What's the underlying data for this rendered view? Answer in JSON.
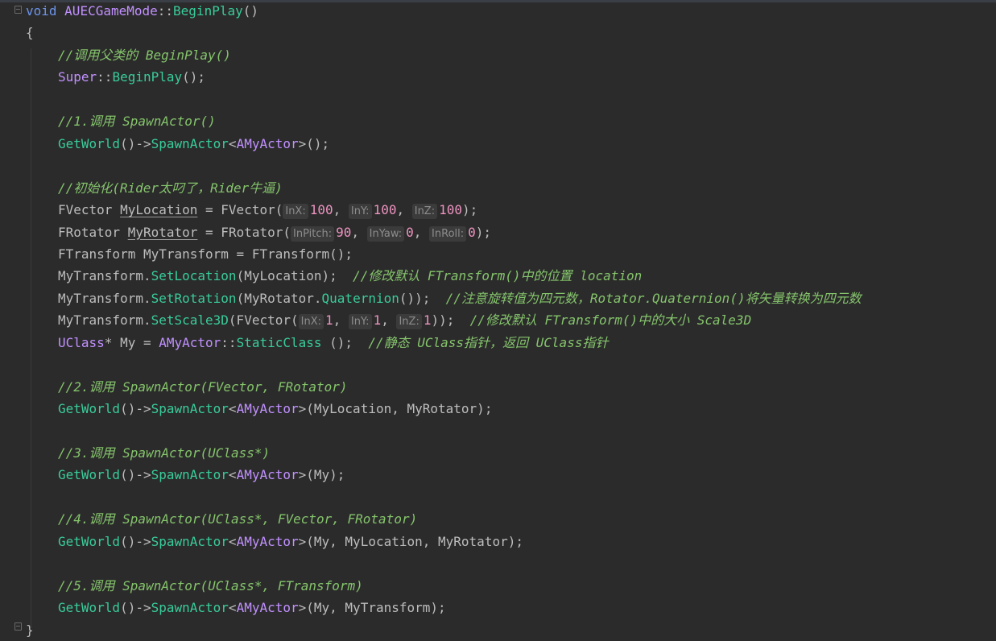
{
  "editor": {
    "lines": [
      {
        "indent": 0,
        "tokens": [
          {
            "kind": "keyword",
            "text": "void"
          },
          {
            "kind": "plain",
            "text": " "
          },
          {
            "kind": "type",
            "text": "AUECGameMode"
          },
          {
            "kind": "plain",
            "text": "::"
          },
          {
            "kind": "func",
            "text": "BeginPlay"
          },
          {
            "kind": "plain",
            "text": "()"
          }
        ]
      },
      {
        "indent": 0,
        "tokens": [
          {
            "kind": "plain",
            "text": "{"
          }
        ]
      },
      {
        "indent": 1,
        "tokens": [
          {
            "kind": "comment",
            "text": "//调用父类的 BeginPlay()"
          }
        ]
      },
      {
        "indent": 1,
        "tokens": [
          {
            "kind": "type",
            "text": "Super"
          },
          {
            "kind": "plain",
            "text": "::"
          },
          {
            "kind": "func",
            "text": "BeginPlay"
          },
          {
            "kind": "plain",
            "text": "();"
          }
        ]
      },
      {
        "indent": 1,
        "tokens": []
      },
      {
        "indent": 1,
        "tokens": [
          {
            "kind": "comment",
            "text": "//1.调用 SpawnActor()"
          }
        ]
      },
      {
        "indent": 1,
        "tokens": [
          {
            "kind": "func",
            "text": "GetWorld"
          },
          {
            "kind": "plain",
            "text": "()->"
          },
          {
            "kind": "func",
            "text": "SpawnActor"
          },
          {
            "kind": "plain",
            "text": "<"
          },
          {
            "kind": "type",
            "text": "AMyActor"
          },
          {
            "kind": "plain",
            "text": ">();"
          }
        ]
      },
      {
        "indent": 1,
        "tokens": []
      },
      {
        "indent": 1,
        "tokens": [
          {
            "kind": "comment",
            "text": "//初始化(Rider太叼了，Rider牛逼)"
          }
        ]
      },
      {
        "indent": 1,
        "tokens": [
          {
            "kind": "plain",
            "text": "FVector "
          },
          {
            "kind": "underline",
            "text": "MyLocation"
          },
          {
            "kind": "plain",
            "text": " = FVector("
          },
          {
            "kind": "hint",
            "text": "InX:"
          },
          {
            "kind": "num",
            "text": "100"
          },
          {
            "kind": "plain",
            "text": ", "
          },
          {
            "kind": "hint",
            "text": "InY:"
          },
          {
            "kind": "num",
            "text": "100"
          },
          {
            "kind": "plain",
            "text": ", "
          },
          {
            "kind": "hint",
            "text": "InZ:"
          },
          {
            "kind": "num",
            "text": "100"
          },
          {
            "kind": "plain",
            "text": ");"
          }
        ]
      },
      {
        "indent": 1,
        "tokens": [
          {
            "kind": "plain",
            "text": "FRotator "
          },
          {
            "kind": "underline",
            "text": "MyRotator"
          },
          {
            "kind": "plain",
            "text": " = FRotator("
          },
          {
            "kind": "hint",
            "text": "InPitch:"
          },
          {
            "kind": "num",
            "text": "90"
          },
          {
            "kind": "plain",
            "text": ", "
          },
          {
            "kind": "hint",
            "text": "InYaw:"
          },
          {
            "kind": "num",
            "text": "0"
          },
          {
            "kind": "plain",
            "text": ", "
          },
          {
            "kind": "hint",
            "text": "InRoll:"
          },
          {
            "kind": "num",
            "text": "0"
          },
          {
            "kind": "plain",
            "text": ");"
          }
        ]
      },
      {
        "indent": 1,
        "tokens": [
          {
            "kind": "plain",
            "text": "FTransform MyTransform = FTransform();"
          }
        ]
      },
      {
        "indent": 1,
        "tokens": [
          {
            "kind": "plain",
            "text": "MyTransform."
          },
          {
            "kind": "func",
            "text": "SetLocation"
          },
          {
            "kind": "plain",
            "text": "(MyLocation);  "
          },
          {
            "kind": "comment",
            "text": "//修改默认 FTransform()中的位置 location"
          }
        ]
      },
      {
        "indent": 1,
        "tokens": [
          {
            "kind": "plain",
            "text": "MyTransform."
          },
          {
            "kind": "func",
            "text": "SetRotation"
          },
          {
            "kind": "plain",
            "text": "(MyRotator."
          },
          {
            "kind": "func",
            "text": "Quaternion"
          },
          {
            "kind": "plain",
            "text": "());  "
          },
          {
            "kind": "comment",
            "text": "//注意旋转值为四元数，Rotator.Quaternion()将矢量转换为四元数"
          }
        ]
      },
      {
        "indent": 1,
        "tokens": [
          {
            "kind": "plain",
            "text": "MyTransform."
          },
          {
            "kind": "func",
            "text": "SetScale3D"
          },
          {
            "kind": "plain",
            "text": "(FVector("
          },
          {
            "kind": "hint",
            "text": "InX:"
          },
          {
            "kind": "num",
            "text": "1"
          },
          {
            "kind": "plain",
            "text": ", "
          },
          {
            "kind": "hint",
            "text": "InY:"
          },
          {
            "kind": "num",
            "text": "1"
          },
          {
            "kind": "plain",
            "text": ", "
          },
          {
            "kind": "hint",
            "text": "InZ:"
          },
          {
            "kind": "num",
            "text": "1"
          },
          {
            "kind": "plain",
            "text": "));  "
          },
          {
            "kind": "comment",
            "text": "//修改默认 FTransform()中的大小 Scale3D"
          }
        ]
      },
      {
        "indent": 1,
        "tokens": [
          {
            "kind": "type",
            "text": "UClass"
          },
          {
            "kind": "plain",
            "text": "* My = "
          },
          {
            "kind": "type",
            "text": "AMyActor"
          },
          {
            "kind": "plain",
            "text": "::"
          },
          {
            "kind": "func",
            "text": "StaticClass"
          },
          {
            "kind": "plain",
            "text": " ();  "
          },
          {
            "kind": "comment",
            "text": "//静态 UClass指针，返回 UClass指针"
          }
        ]
      },
      {
        "indent": 1,
        "tokens": []
      },
      {
        "indent": 1,
        "tokens": [
          {
            "kind": "comment",
            "text": "//2.调用 SpawnActor(FVector, FRotator)"
          }
        ]
      },
      {
        "indent": 1,
        "tokens": [
          {
            "kind": "func",
            "text": "GetWorld"
          },
          {
            "kind": "plain",
            "text": "()->"
          },
          {
            "kind": "func",
            "text": "SpawnActor"
          },
          {
            "kind": "plain",
            "text": "<"
          },
          {
            "kind": "type",
            "text": "AMyActor"
          },
          {
            "kind": "plain",
            "text": ">(MyLocation, MyRotator);"
          }
        ]
      },
      {
        "indent": 1,
        "tokens": []
      },
      {
        "indent": 1,
        "tokens": [
          {
            "kind": "comment",
            "text": "//3.调用 SpawnActor(UClass*)"
          }
        ]
      },
      {
        "indent": 1,
        "tokens": [
          {
            "kind": "func",
            "text": "GetWorld"
          },
          {
            "kind": "plain",
            "text": "()->"
          },
          {
            "kind": "func",
            "text": "SpawnActor"
          },
          {
            "kind": "plain",
            "text": "<"
          },
          {
            "kind": "type",
            "text": "AMyActor"
          },
          {
            "kind": "plain",
            "text": ">(My);"
          }
        ]
      },
      {
        "indent": 1,
        "tokens": []
      },
      {
        "indent": 1,
        "tokens": [
          {
            "kind": "comment",
            "text": "//4.调用 SpawnActor(UClass*, FVector, FRotator)"
          }
        ]
      },
      {
        "indent": 1,
        "tokens": [
          {
            "kind": "func",
            "text": "GetWorld"
          },
          {
            "kind": "plain",
            "text": "()->"
          },
          {
            "kind": "func",
            "text": "SpawnActor"
          },
          {
            "kind": "plain",
            "text": "<"
          },
          {
            "kind": "type",
            "text": "AMyActor"
          },
          {
            "kind": "plain",
            "text": ">(My, MyLocation, MyRotator);"
          }
        ]
      },
      {
        "indent": 1,
        "tokens": []
      },
      {
        "indent": 1,
        "tokens": [
          {
            "kind": "comment",
            "text": "//5.调用 SpawnActor(UClass*, FTransform)"
          }
        ]
      },
      {
        "indent": 1,
        "tokens": [
          {
            "kind": "func",
            "text": "GetWorld"
          },
          {
            "kind": "plain",
            "text": "()->"
          },
          {
            "kind": "func",
            "text": "SpawnActor"
          },
          {
            "kind": "plain",
            "text": "<"
          },
          {
            "kind": "type",
            "text": "AMyActor"
          },
          {
            "kind": "plain",
            "text": ">(My, MyTransform);"
          }
        ]
      },
      {
        "indent": 0,
        "tokens": [
          {
            "kind": "plain",
            "text": "}"
          }
        ]
      }
    ]
  },
  "colors": {
    "background": "#2b2b2b",
    "keyword": "#6c95eb",
    "type": "#c191ff",
    "function": "#39cc9b",
    "comment": "#85c46c",
    "number": "#ed94c0",
    "plain": "#bdbdbd"
  }
}
